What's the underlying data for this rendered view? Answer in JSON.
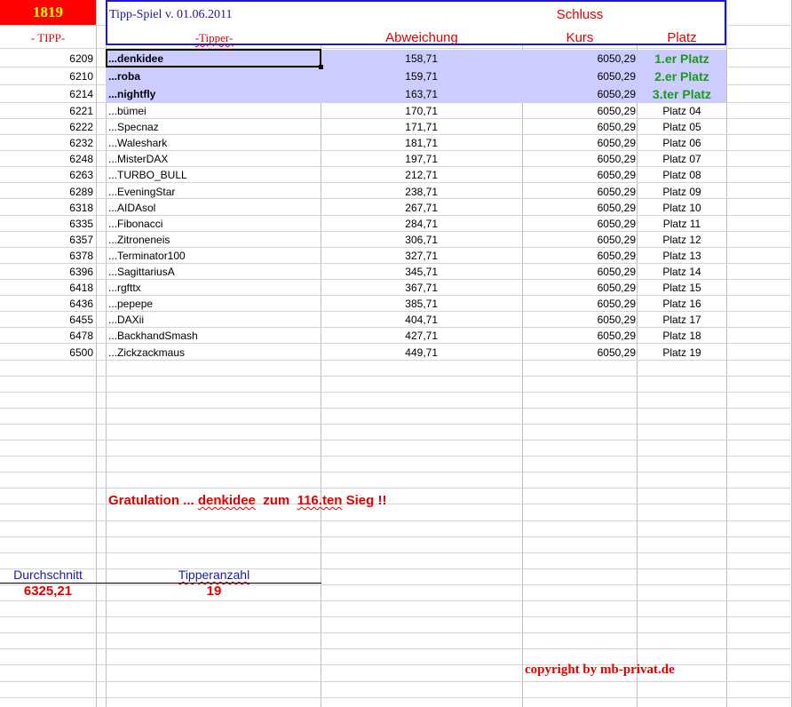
{
  "header": {
    "year": "1819",
    "title": "Tipp-Spiel v. 01.06.2011",
    "schluss": "Schluss",
    "col_tipp": "- TIPP-",
    "col_tipper": "-Tipper-",
    "col_abweichung": "Abweichung",
    "col_kurs": "Kurs",
    "col_platz": "Platz"
  },
  "rows": [
    {
      "tipp": "6209",
      "tipper": "...denkidee",
      "abw": "158,71",
      "kurs": "6050,29",
      "platz": "1.er Platz"
    },
    {
      "tipp": "6210",
      "tipper": "...roba",
      "abw": "159,71",
      "kurs": "6050,29",
      "platz": "2.er Platz"
    },
    {
      "tipp": "6214",
      "tipper": "...nightfly",
      "abw": "163,71",
      "kurs": "6050,29",
      "platz": "3.ter Platz"
    },
    {
      "tipp": "6221",
      "tipper": "...bümei",
      "abw": "170,71",
      "kurs": "6050,29",
      "platz": "Platz 04"
    },
    {
      "tipp": "6222",
      "tipper": "...Specnaz",
      "abw": "171,71",
      "kurs": "6050,29",
      "platz": "Platz 05"
    },
    {
      "tipp": "6232",
      "tipper": "...Waleshark",
      "abw": "181,71",
      "kurs": "6050,29",
      "platz": "Platz 06"
    },
    {
      "tipp": "6248",
      "tipper": "...MisterDAX",
      "abw": "197,71",
      "kurs": "6050,29",
      "platz": "Platz 07"
    },
    {
      "tipp": "6263",
      "tipper": "...TURBO_BULL",
      "abw": "212,71",
      "kurs": "6050,29",
      "platz": "Platz 08"
    },
    {
      "tipp": "6289",
      "tipper": "...EveningStar",
      "abw": "238,71",
      "kurs": "6050,29",
      "platz": "Platz 09"
    },
    {
      "tipp": "6318",
      "tipper": "...AIDAsol",
      "abw": "267,71",
      "kurs": "6050,29",
      "platz": "Platz 10"
    },
    {
      "tipp": "6335",
      "tipper": "...Fibonacci",
      "abw": "284,71",
      "kurs": "6050,29",
      "platz": "Platz 11"
    },
    {
      "tipp": "6357",
      "tipper": "...Zitroneneis",
      "abw": "306,71",
      "kurs": "6050,29",
      "platz": "Platz 12"
    },
    {
      "tipp": "6378",
      "tipper": "...Terminator100",
      "abw": "327,71",
      "kurs": "6050,29",
      "platz": "Platz 13"
    },
    {
      "tipp": "6396",
      "tipper": "...SagittariusA",
      "abw": "345,71",
      "kurs": "6050,29",
      "platz": "Platz 14"
    },
    {
      "tipp": "6418",
      "tipper": "...rgfttx",
      "abw": "367,71",
      "kurs": "6050,29",
      "platz": "Platz 15"
    },
    {
      "tipp": "6436",
      "tipper": "...pepepe",
      "abw": "385,71",
      "kurs": "6050,29",
      "platz": "Platz 16"
    },
    {
      "tipp": "6455",
      "tipper": "...DAXii",
      "abw": "404,71",
      "kurs": "6050,29",
      "platz": "Platz 17"
    },
    {
      "tipp": "6478",
      "tipper": "...BackhandSmash",
      "abw": "427,71",
      "kurs": "6050,29",
      "platz": "Platz 18"
    },
    {
      "tipp": "6500",
      "tipper": "...Zickzackmaus",
      "abw": "449,71",
      "kurs": "6050,29",
      "platz": "Platz 19"
    }
  ],
  "congrats": {
    "prefix": "Gratulation  ...",
    "name": "denkidee",
    "middle": "zum",
    "count": "116.ten",
    "suffix": "Sieg !!"
  },
  "summary": {
    "avg_label": "Durchschnitt",
    "avg_value": "6325,21",
    "count_label": "Tipperanzahl",
    "count_value": "19"
  },
  "copyright": "copyright by mb-privat.de",
  "colors": {
    "year_bg": "#ff0000",
    "year_fg": "#ffff00",
    "header_border": "#1a1ac8",
    "highlight": "#ccccff",
    "red": "#e00000",
    "green": "#1a9a1a",
    "blue": "#1a1aa0"
  }
}
